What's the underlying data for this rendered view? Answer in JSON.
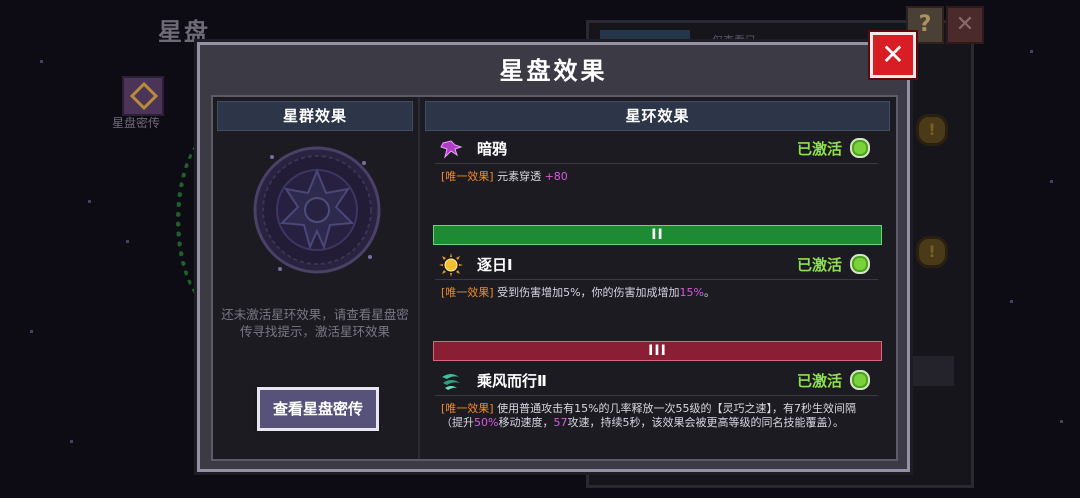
{
  "background": {
    "title": "星盘",
    "icon_label": "星盘密传",
    "tab_label": "仅查看已",
    "help_icon": "question-icon",
    "close_icon": "close-icon"
  },
  "modal": {
    "title": "星盘效果",
    "close_icon": "close-icon",
    "left": {
      "header": "星群效果",
      "hint": "还未激活星环效果，请查看星盘密传寻找提示，激活星环效果",
      "button_label": "查看星盘密传"
    },
    "right": {
      "header": "星环效果",
      "effects": [
        {
          "name": "暗鸦",
          "status": "已激活",
          "tag": "[唯一效果]",
          "desc_before": " 元素穿透 ",
          "desc_hl": "+80",
          "desc_after": "",
          "icon": "raven-icon"
        },
        {
          "tier": "II",
          "name": "逐日Ⅰ",
          "status": "已激活",
          "tag": "[唯一效果]",
          "desc_before": " 受到伤害增加5%，你的伤害加成增加",
          "desc_hl": "15%",
          "desc_after": "。",
          "icon": "sun-icon"
        },
        {
          "tier": "III",
          "name": "乘风而行Ⅱ",
          "status": "已激活",
          "tag": "[唯一效果]",
          "desc_before": " 使用普通攻击有15%的几率释放一次55级的【灵巧之速】，有7秒生效间隔（提升",
          "desc_hl": "50%",
          "desc_mid": "移动速度，",
          "desc_hl2": "57",
          "desc_after": "攻速，持续5秒，该效果会被更高等级的同名技能覆盖）。",
          "icon": "wind-icon"
        }
      ]
    }
  },
  "colors": {
    "status_active": "#8ee04c",
    "tag": "#f08a2a",
    "highlight": "#d85ae0",
    "tier2": "#1f8a34",
    "tier3": "#8a1e34",
    "close_button": "#d81e24"
  }
}
